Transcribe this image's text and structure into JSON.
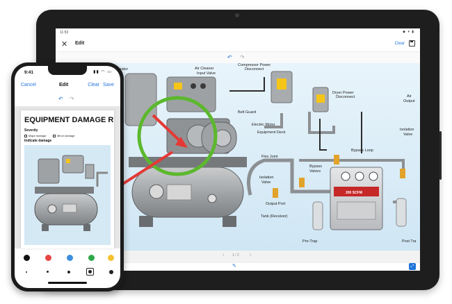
{
  "tablet": {
    "status": {
      "time": "11:53",
      "icons": "◆ ▾ ▮"
    },
    "appbar": {
      "close_glyph": "✕",
      "title": "Edit",
      "clear_label": "Clear"
    },
    "undo_glyph": "↶",
    "redo_glyph": "↷",
    "diagram_labels": {
      "separator": "Separator",
      "air_cleaner": "Air Cleaner",
      "input_valve": "Input Valve",
      "compressor_power": "Compressor Power",
      "disconnect": "Disconnect",
      "dryer_power": "Dryer Power",
      "dryer_disconnect": "Disconnect",
      "air": "Air",
      "output": "Output",
      "belt_guard": "Belt Guard",
      "electric_motor": "Electric Motor",
      "equipment_deck": "Equipment Deck",
      "isolation": "Isolation",
      "valve": "Valve",
      "bypass_loop": "Bypass Loop",
      "flex_joint": "Flex Joint",
      "bypass": "Bypass",
      "valves": "Valves",
      "isolation_valve_1": "Isolation",
      "isolation_valve_2": "Valve",
      "output_port": "Output Port",
      "tank": "Tank (Receiver)",
      "pre_trap": "Pre-Trap",
      "post_trap": "Post Tra",
      "dryer_rating": "200 SCFM"
    },
    "pager": {
      "prev": "‹",
      "page": "1 / 2",
      "next": "›"
    },
    "bottom": {
      "pen_glyph": "✎",
      "fab_glyph": "⤢"
    }
  },
  "phone": {
    "status": {
      "time": "9:41",
      "icons": "▮▮ ◠ ▭"
    },
    "nav": {
      "cancel": "Cancel",
      "title": "Edit",
      "clear": "Clear",
      "save": "Save"
    },
    "undo_glyph": "↶",
    "redo_glyph": "↷",
    "document": {
      "title": "EQUIPMENT DAMAGE R",
      "severity_label": "Severity",
      "options": [
        "Major damage",
        "Minor damage"
      ],
      "indicate_label": "Indicate damage"
    },
    "palette": [
      "#111111",
      "#e84545",
      "#3d8fe0",
      "#2fa84a",
      "#f2c230"
    ],
    "selected_size_index": 3
  },
  "colors": {
    "accent": "#1e73d8",
    "annotation_circle": "#5cb82e",
    "annotation_arrow": "#e53935",
    "machine_gray": "#a9abad",
    "diagram_bg": "#d8ecf7"
  }
}
